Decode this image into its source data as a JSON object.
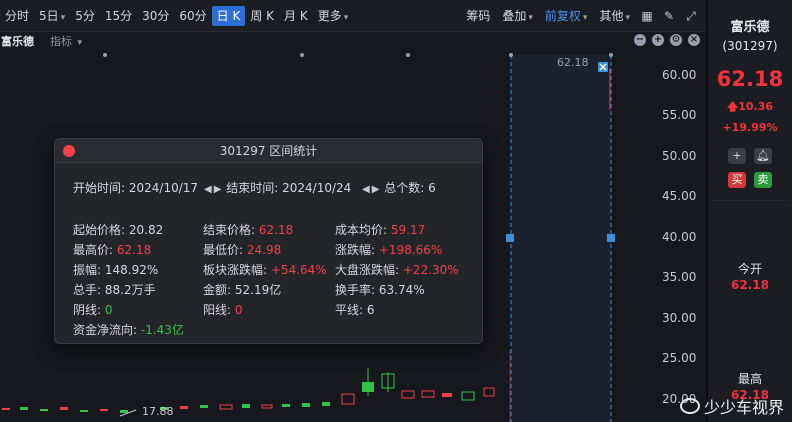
{
  "toolbar": {
    "periods": [
      "分时",
      "5日",
      "5分",
      "15分",
      "30分",
      "60分",
      "日 K",
      "周 K",
      "月 K",
      "更多"
    ],
    "active_period": "日 K",
    "right_items": {
      "chips": "筹码",
      "overlay": "叠加",
      "adjust": "前复权",
      "other": "其他"
    }
  },
  "subbar": {
    "stock_name": "富乐德",
    "indicator": "指标"
  },
  "price_axis": [
    "60.00",
    "55.00",
    "50.00",
    "45.00",
    "40.00",
    "35.00",
    "30.00",
    "25.00",
    "20.00"
  ],
  "chart_labels": {
    "top_price": "62.18",
    "low_price": "17.88"
  },
  "side": {
    "name": "富乐德",
    "code": "(301297)",
    "price": "62.18",
    "change": "10.36",
    "change_pct": "+19.99%",
    "buy": "买",
    "sell": "卖",
    "open_label": "今开",
    "open_value": "62.18",
    "high_label": "最高",
    "high_value": "62.18"
  },
  "dialog": {
    "title": "301297 区间统计",
    "start_label": "开始时间:",
    "start_date": "2024/10/17",
    "end_label": "结束时间:",
    "end_date": "2024/10/24",
    "count_label": "总个数:",
    "count": "6",
    "rows": [
      [
        {
          "k": "起始价格:",
          "v": "20.82",
          "c": ""
        },
        {
          "k": "结束价格:",
          "v": "62.18",
          "c": "red"
        },
        {
          "k": "成本均价:",
          "v": "59.17",
          "c": "red"
        }
      ],
      [
        {
          "k": "最高价:",
          "v": "62.18",
          "c": "red"
        },
        {
          "k": "最低价:",
          "v": "24.98",
          "c": "red"
        },
        {
          "k": "涨跌幅:",
          "v": "+198.66%",
          "c": "red"
        }
      ],
      [
        {
          "k": "振幅:",
          "v": "148.92%",
          "c": ""
        },
        {
          "k": "板块涨跌幅:",
          "v": "+54.64%",
          "c": "red"
        },
        {
          "k": "大盘涨跌幅:",
          "v": "+22.30%",
          "c": "red"
        }
      ],
      [
        {
          "k": "总手:",
          "v": "88.2万手",
          "c": ""
        },
        {
          "k": "金额:",
          "v": "52.19亿",
          "c": ""
        },
        {
          "k": "换手率:",
          "v": "63.74%",
          "c": ""
        }
      ],
      [
        {
          "k": "阴线:",
          "v": "0",
          "c": "grn"
        },
        {
          "k": "阳线:",
          "v": "0",
          "c": "red"
        },
        {
          "k": "平线:",
          "v": "6",
          "c": ""
        }
      ],
      [
        {
          "k": "资金净流向:",
          "v": "-1.43亿",
          "c": "grn"
        }
      ]
    ]
  },
  "watermark": "少少车视界",
  "colors": {
    "up": "#f0404a",
    "down": "#35c24a",
    "accent": "#2c6fd1"
  }
}
